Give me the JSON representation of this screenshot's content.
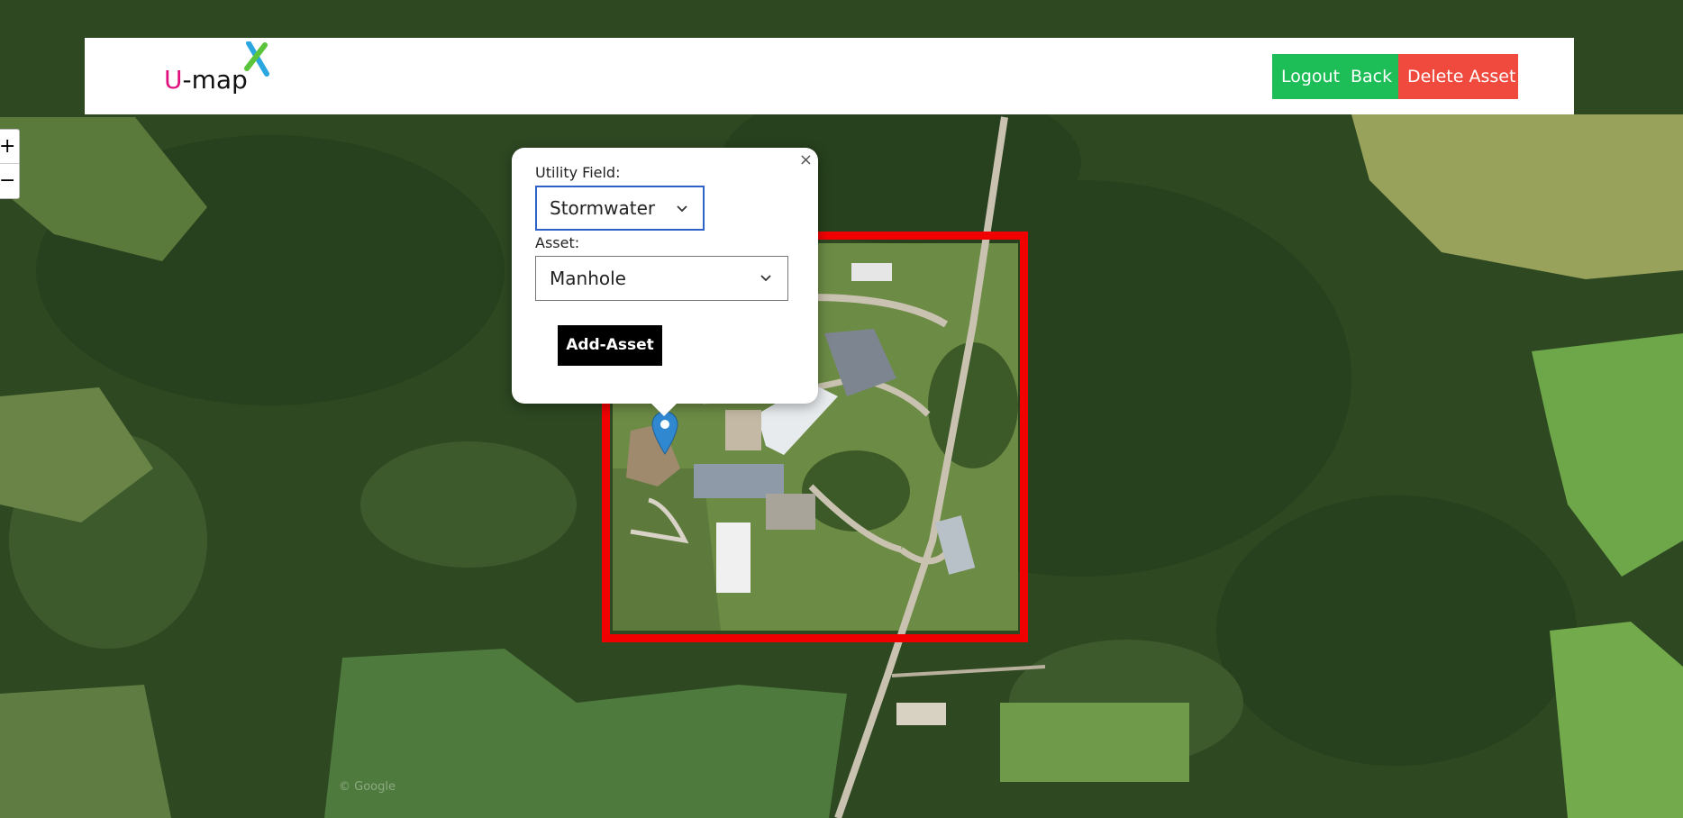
{
  "app": {
    "logo_text_u": "U",
    "logo_text_rest": "-map",
    "logo_mark_colors": {
      "blue": "#2aa7e0",
      "green": "#5ac43a"
    }
  },
  "header": {
    "buttons": {
      "logout": "Logout",
      "back": "Back",
      "delete_asset": "Delete Asset"
    },
    "colors": {
      "green": "#1dbe57",
      "red": "#f04a3e"
    }
  },
  "map": {
    "zoom_in": "+",
    "zoom_out": "−",
    "boundary_color": "#f10000",
    "marker_color": "#2f88d0",
    "watermark": "© Google"
  },
  "popup": {
    "close": "×",
    "utility_field_label": "Utility Field:",
    "utility_field_value": "Stormwater",
    "asset_label": "Asset:",
    "asset_value": "Manhole",
    "add_button": "Add-Asset",
    "focus_color": "#2f62c8"
  }
}
